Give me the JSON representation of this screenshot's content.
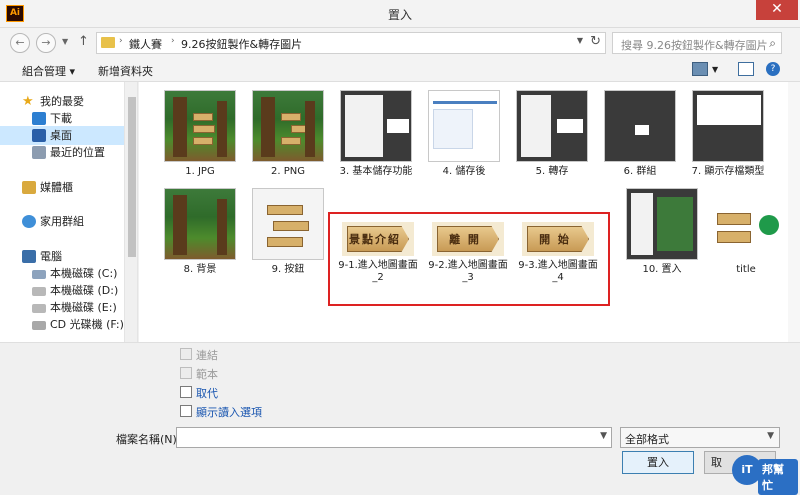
{
  "window": {
    "title": "置入",
    "app_icon": "Ai",
    "close_glyph": "✕"
  },
  "nav": {
    "breadcrumb": [
      "鐵人賽",
      "9.26按鈕製作&轉存圖片"
    ],
    "search_placeholder": "搜尋 9.26按鈕製作&轉存圖片"
  },
  "toolbar": {
    "organize": "組合管理 ▾",
    "new_folder": "新增資料夾"
  },
  "sidebar": {
    "items": [
      {
        "label": "我的最愛",
        "icon": "star-icon"
      },
      {
        "label": "下載",
        "icon": "download-icon"
      },
      {
        "label": "桌面",
        "icon": "desktop-icon",
        "selected": true
      },
      {
        "label": "最近的位置",
        "icon": "recent-icon"
      },
      {
        "label": "媒體櫃",
        "icon": "library-icon"
      },
      {
        "label": "家用群組",
        "icon": "homegroup-icon"
      },
      {
        "label": "電腦",
        "icon": "computer-icon"
      },
      {
        "label": "本機磁碟 (C:)",
        "icon": "drive-icon"
      },
      {
        "label": "本機磁碟 (D:)",
        "icon": "drive-icon"
      },
      {
        "label": "本機磁碟 (E:)",
        "icon": "drive-icon"
      },
      {
        "label": "CD 光碟機 (F:) G",
        "icon": "cd-icon"
      }
    ]
  },
  "files": [
    {
      "label": "1. JPG"
    },
    {
      "label": "2. PNG"
    },
    {
      "label": "3. 基本儲存功能"
    },
    {
      "label": "4. 儲存後"
    },
    {
      "label": "5. 轉存"
    },
    {
      "label": "6. 群組"
    },
    {
      "label": "7. 顯示存檔類型"
    },
    {
      "label": "8. 背景"
    },
    {
      "label": "9. 按鈕"
    },
    {
      "label": "9-1.進入地圖畫面_2",
      "sign": "景點介紹"
    },
    {
      "label": "9-2.進入地圖畫面_3",
      "sign": "離 開"
    },
    {
      "label": "9-3.進入地圖畫面_4",
      "sign": "開 始"
    },
    {
      "label": "10. 置入"
    },
    {
      "label": "title"
    }
  ],
  "options": {
    "link": "連結",
    "template": "範本",
    "replace": "取代",
    "show_import": "顯示讀入選項"
  },
  "footer": {
    "filename_label": "檔案名稱(N):",
    "filetype": "全部格式",
    "place_button": "置入",
    "cancel_button": "取"
  },
  "watermark": {
    "circle": "iT",
    "text": "邦幫忙"
  }
}
